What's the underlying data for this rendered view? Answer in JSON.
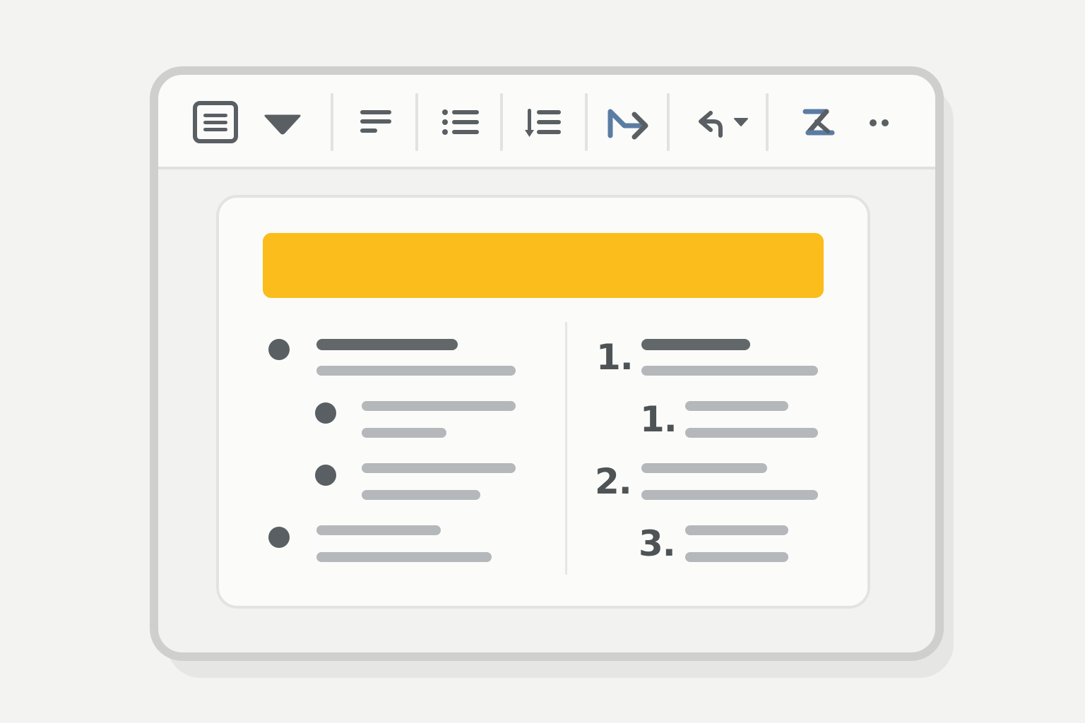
{
  "colors": {
    "accent_banner": "#fbbd1b",
    "icon_dark": "#5a5f63",
    "icon_blue": "#5b7ca3",
    "line_dark": "#62676a",
    "line_light": "#b5b8bb"
  },
  "toolbar": {
    "items": [
      {
        "name": "paragraph-style-icon"
      },
      {
        "name": "style-dropdown-arrow-icon"
      },
      {
        "name": "align-left-icon"
      },
      {
        "name": "bulleted-list-icon"
      },
      {
        "name": "line-spacing-icon"
      },
      {
        "name": "indent-arrow-icon"
      },
      {
        "name": "undo-icon"
      },
      {
        "name": "clear-formatting-icon"
      },
      {
        "name": "more-options-icon"
      }
    ]
  },
  "document": {
    "numbered_list": {
      "markers": [
        "1.",
        "1.",
        "2.",
        "3."
      ]
    }
  }
}
